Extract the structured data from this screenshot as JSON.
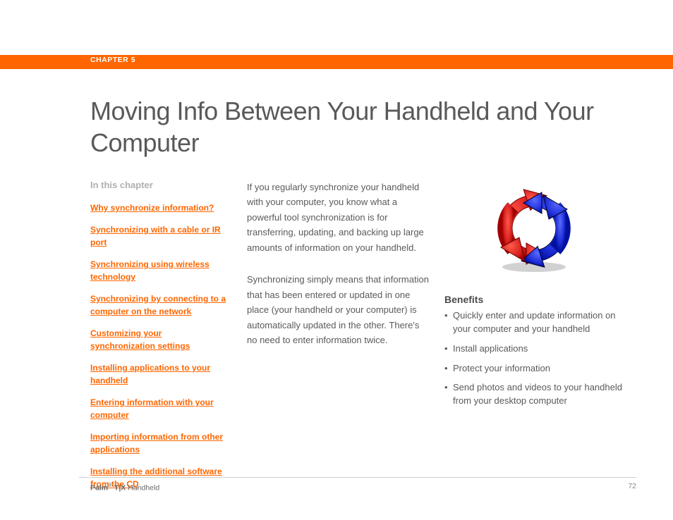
{
  "header": {
    "chapter_label": "CHAPTER 5"
  },
  "title": "Moving Info Between Your Handheld and Your Computer",
  "toc": {
    "heading": "In this chapter",
    "items": [
      "Why synchronize information?",
      "Synchronizing with a cable or IR port",
      "Synchronizing using wireless technology",
      "Synchronizing by connecting to a computer on the network",
      "Customizing your synchronization settings",
      "Installing applications to your handheld",
      "Entering information with your computer",
      "Importing information from other applications",
      "Installing the additional software from the CD"
    ]
  },
  "body": {
    "para1": "If you regularly synchronize your handheld with your computer, you know what a powerful tool synchronization is for transferring, updating, and backing up large amounts of information on your handheld.",
    "para2": "Synchronizing simply means that information that has been entered or updated in one place (your handheld or your computer) is automatically updated in the other. There's no need to enter information twice."
  },
  "benefits": {
    "heading": "Benefits",
    "items": [
      "Quickly enter and update information on your computer and your handheld",
      "Install applications",
      "Protect your information",
      "Send photos and videos to your handheld from your desktop computer"
    ]
  },
  "footer": {
    "product_bold": "Palm",
    "product_model": " T|X",
    "product_suffix": " Handheld",
    "page": "72"
  },
  "colors": {
    "orange": "#ff6600"
  }
}
